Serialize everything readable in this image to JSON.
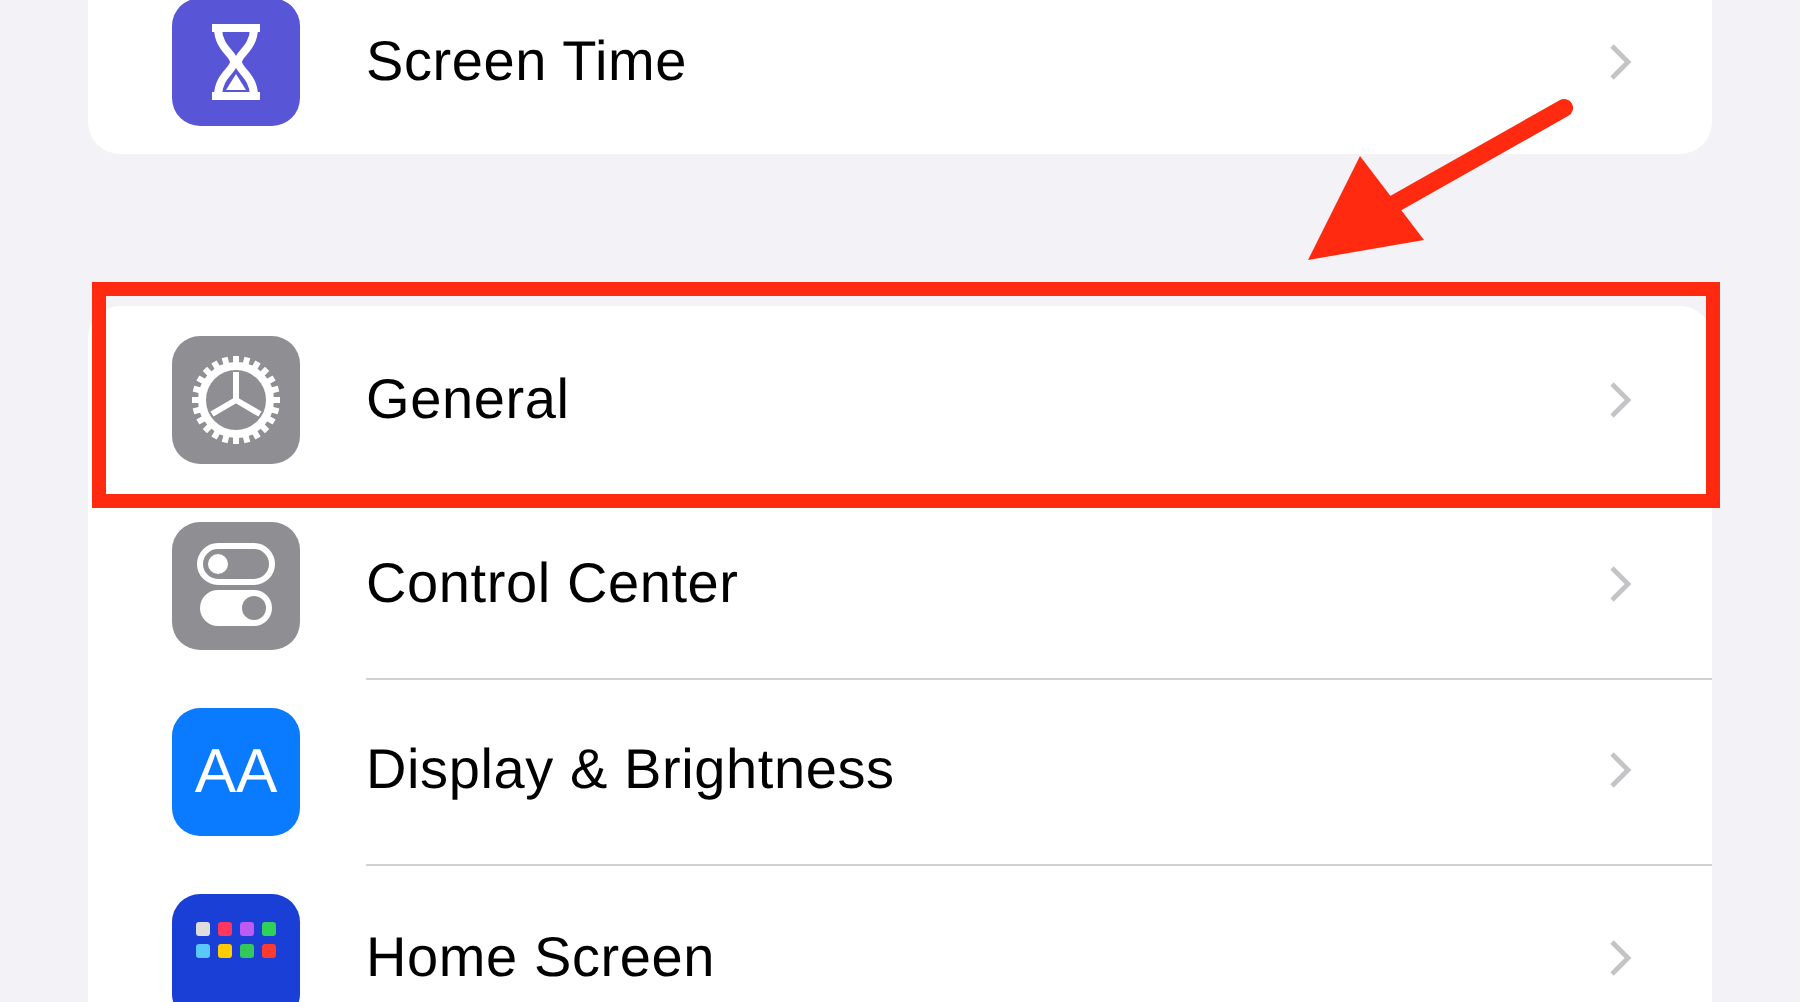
{
  "groups": [
    {
      "items": [
        {
          "label": "Screen Time",
          "kind": "hourglass",
          "highlighted": false
        }
      ]
    },
    {
      "items": [
        {
          "label": "General",
          "kind": "gear",
          "highlighted": true
        },
        {
          "label": "Control Center",
          "kind": "switches",
          "highlighted": false
        },
        {
          "label": "Display & Brightness",
          "kind": "text",
          "icon_text": "AA",
          "highlighted": false
        },
        {
          "label": "Home Screen",
          "kind": "apps",
          "highlighted": false
        }
      ]
    }
  ]
}
